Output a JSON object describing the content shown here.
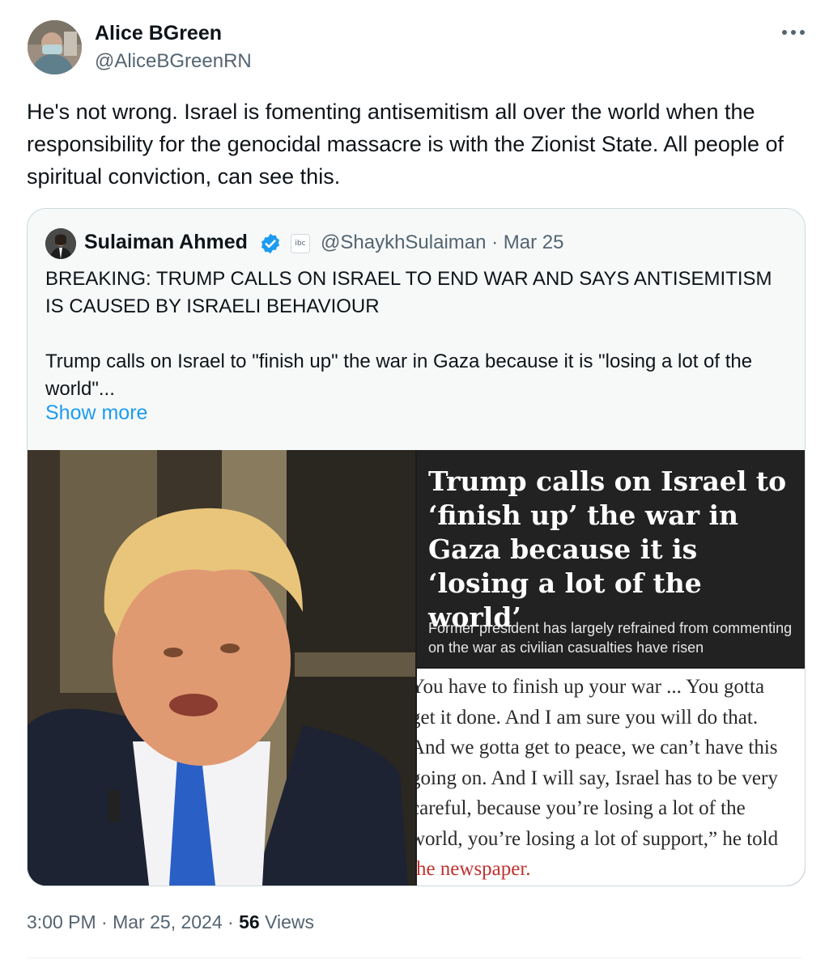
{
  "tweet": {
    "author": {
      "name": "Alice BGreen",
      "handle": "@AliceBGreenRN"
    },
    "text": "He's not wrong. Israel is fomenting antisemitism all over the world when the responsibility for the genocidal massacre is with the Zionist State. All people of spiritual conviction, can see this.",
    "time": "3:00 PM",
    "date": "Mar 25, 2024",
    "views_count": "56",
    "views_label": "Views"
  },
  "quote": {
    "author": {
      "name": "Sulaiman Ahmed",
      "handle": "@ShaykhSulaiman",
      "date": "Mar 25",
      "affiliate_badge": "ibc"
    },
    "text_line1": "BREAKING: TRUMP CALLS ON ISRAEL TO END WAR AND SAYS ANTISEMITISM IS CAUSED BY ISRAELI BEHAVIOUR",
    "text_line2": "Trump calls on Israel to \"finish up\" the war in Gaza because it is \"losing a lot of the world\"...",
    "show_more": "Show more",
    "media": {
      "headline": "Trump calls on Israel to ‘finish up’ the war in Gaza because it is ‘losing a lot of the world’",
      "subhead": "Former president has largely refrained from commenting on the war as civilian casualties have risen",
      "article_lines": [
        "You have to finish up your war ... You gotta",
        "get it done. And I am sure you will do that.",
        "And we gotta get to peace, we can’t have this",
        "going on. And I will say, Israel has to be very",
        "careful, because you’re losing a lot of the",
        "world, you’re losing a lot of support,” he told"
      ],
      "article_link": "the newspaper."
    }
  },
  "colors": {
    "primary_text": "#0f1419",
    "secondary_text": "#536471",
    "link": "#1d9bf0",
    "verified": "#1d9bf0",
    "border": "#cfd9de"
  },
  "icons": [
    "more-icon",
    "verified-icon",
    "affiliate-badge-icon"
  ]
}
